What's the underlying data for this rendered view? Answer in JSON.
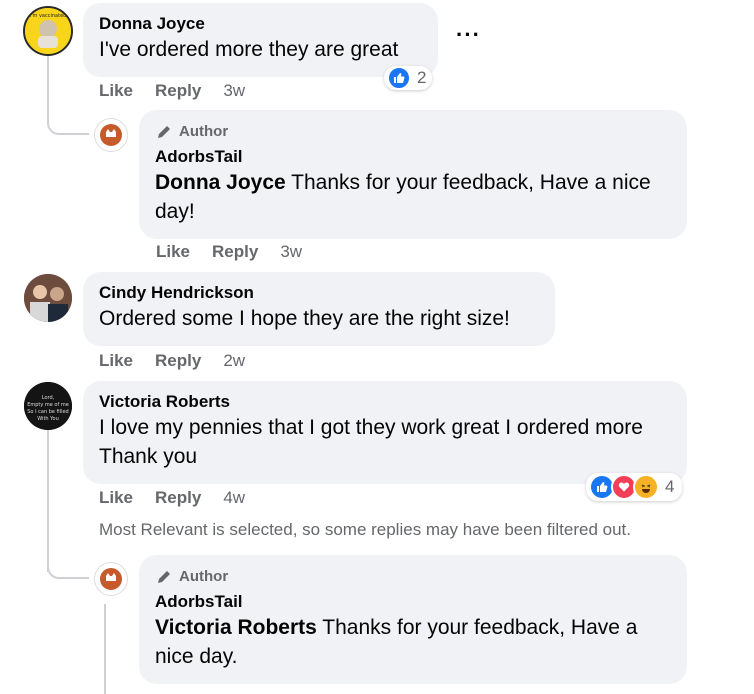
{
  "comments": [
    {
      "name": "Donna Joyce",
      "text": "I've ordered more they are great",
      "reaction_count": "2",
      "like": "Like",
      "reply": "Reply",
      "time": "3w",
      "avatar_text": "I'm vaccinated"
    },
    {
      "author_badge": "Author",
      "name": "AdorbsTail",
      "mention": "Donna Joyce",
      "text": " Thanks for your feedback, Have a nice day!",
      "like": "Like",
      "reply": "Reply",
      "time": "3w"
    },
    {
      "name": "Cindy Hendrickson",
      "text": "Ordered some I hope they are the right size!",
      "like": "Like",
      "reply": "Reply",
      "time": "2w"
    },
    {
      "name": "Victoria Roberts",
      "text": "I love my pennies that I got they work great I ordered more Thank you",
      "reaction_count": "4",
      "like": "Like",
      "reply": "Reply",
      "time": "4w",
      "avatar_text": "Lord, Empty me of me. So I can be filled With You"
    },
    {
      "author_badge": "Author",
      "name": "AdorbsTail",
      "mention": "Victoria Roberts",
      "text": " Thanks for your feedback, Have a nice day."
    }
  ],
  "filter_note": "Most Relevant is selected, so some replies may have been filtered out.",
  "colors": {
    "bubble": "#f0f2f5",
    "secondary_text": "#65676b",
    "like_blue": "#1877f2",
    "love_red": "#f33e58",
    "haha_yellow": "#f7b125"
  }
}
